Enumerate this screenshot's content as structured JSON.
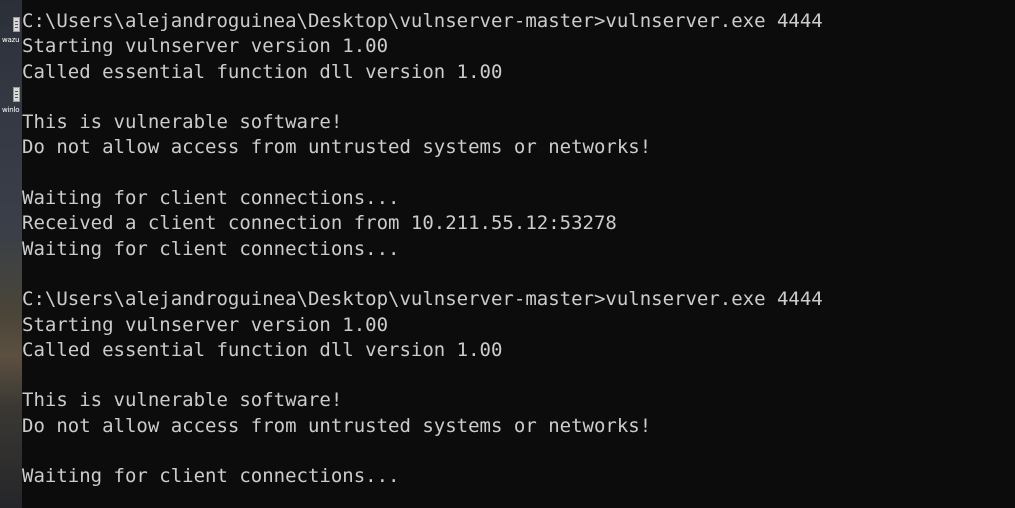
{
  "desktop": {
    "icons": [
      {
        "label": "wazu",
        "icon": "file-icon"
      },
      {
        "label": "winlo",
        "icon": "file-icon"
      }
    ]
  },
  "console": {
    "lines": [
      "C:\\Users\\alejandroguinea\\Desktop\\vulnserver-master>vulnserver.exe 4444",
      "Starting vulnserver version 1.00",
      "Called essential function dll version 1.00",
      "",
      "This is vulnerable software!",
      "Do not allow access from untrusted systems or networks!",
      "",
      "Waiting for client connections...",
      "Received a client connection from 10.211.55.12:53278",
      "Waiting for client connections...",
      "",
      "C:\\Users\\alejandroguinea\\Desktop\\vulnserver-master>vulnserver.exe 4444",
      "Starting vulnserver version 1.00",
      "Called essential function dll version 1.00",
      "",
      "This is vulnerable software!",
      "Do not allow access from untrusted systems or networks!",
      "",
      "Waiting for client connections..."
    ],
    "background": "#0c0c0c",
    "foreground": "#cccccc"
  }
}
